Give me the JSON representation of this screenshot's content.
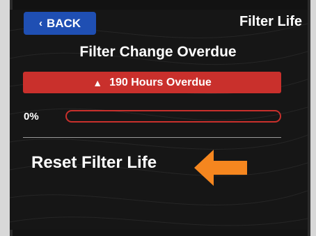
{
  "header": {
    "back_label": "BACK",
    "back_icon": "chevron-left-icon",
    "title": "Filter Life"
  },
  "status": {
    "title": "Filter Change Overdue",
    "banner_text": "190 Hours Overdue",
    "banner_icon": "warning-triangle-icon",
    "banner_color": "#c9302c"
  },
  "progress": {
    "label": "0%",
    "value_fraction": 0.0,
    "bar_color": "#c9302c"
  },
  "action": {
    "reset_label": "Reset Filter Life",
    "pointer_icon": "arrow-left-icon",
    "pointer_color": "#f5861f"
  },
  "colors": {
    "accent_blue": "#1f4fb3",
    "screen_bg": "#161616"
  }
}
